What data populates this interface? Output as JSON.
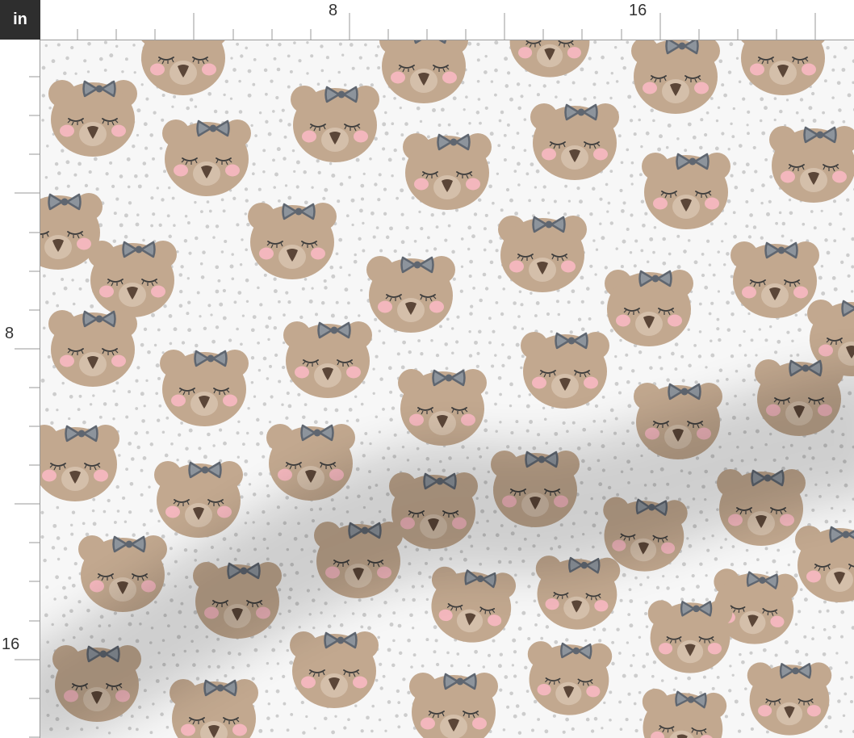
{
  "ruler": {
    "unit": "in",
    "top_labels": [
      "8",
      "16"
    ],
    "left_labels": [
      "8",
      "16"
    ]
  },
  "fabric": {
    "motif": "sleepy-bear-with-bow",
    "colors": {
      "background": "#f7f7f7",
      "dots": "#cdcdcd",
      "bear_fur": "#c2a88f",
      "bear_ear_inner": "#b49a81",
      "muzzle": "#d4bfaa",
      "nose": "#5b4638",
      "cheeks": "#f3b7bd",
      "bow": "#5f6670",
      "bow_fill": "#8d949c",
      "eyelash": "#3b3b3b",
      "shadow": "#000000"
    }
  }
}
